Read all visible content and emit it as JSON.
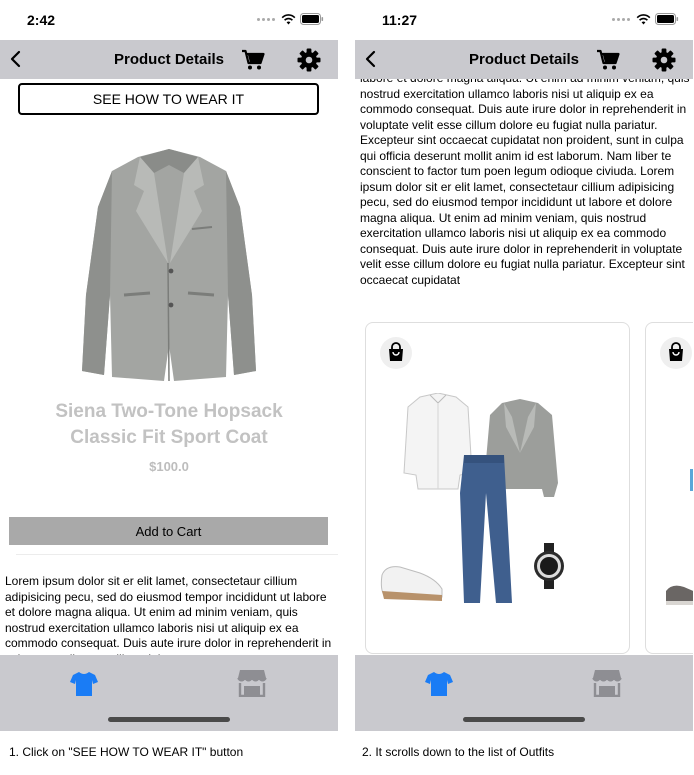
{
  "screens": [
    {
      "status": {
        "time": "2:42"
      },
      "nav": {
        "title": "Product Details",
        "back_icon": "chevron-left-icon",
        "cart_icon": "cart-icon",
        "settings_icon": "gear-icon"
      },
      "wear_button_label": "SEE HOW TO WEAR IT",
      "product": {
        "name_line1": "Siena Two-Tone Hopsack",
        "name_line2": "Classic Fit Sport Coat",
        "price": "$100.0",
        "add_to_cart_label": "Add to Cart"
      },
      "description": "Lorem ipsum dolor sit er elit lamet, consectetaur cillium adipisicing pecu, sed do eiusmod tempor incididunt ut labore et dolore magna aliqua. Ut enim ad minim veniam, quis nostrud exercitation ullamco laboris nisi ut aliquip ex ea commodo consequat. Duis aute irure dolor in reprehenderit in voluptate velit esse cillum dolore eu",
      "tabs": {
        "shop_icon": "shirt-icon",
        "store_icon": "store-icon"
      },
      "caption": "1. Click on \"SEE HOW TO WEAR IT\" button"
    },
    {
      "status": {
        "time": "11:27"
      },
      "nav": {
        "title": "Product Details",
        "back_icon": "chevron-left-icon",
        "cart_icon": "cart-icon",
        "settings_icon": "gear-icon"
      },
      "description": "labore et dolore magna aliqua. Ut enim ad minim veniam, quis nostrud exercitation ullamco laboris nisi ut aliquip ex ea commodo consequat. Duis aute irure dolor in reprehenderit in voluptate velit esse cillum dolore eu fugiat nulla pariatur. Excepteur sint occaecat cupidatat non proident, sunt in culpa qui officia deserunt mollit anim id est laborum. Nam liber te conscient to factor tum poen legum odioque civiuda. Lorem ipsum dolor sit er elit lamet, consectetaur cillium adipisicing pecu, sed do eiusmod tempor incididunt ut labore et dolore magna aliqua. Ut enim ad minim veniam, quis nostrud exercitation ullamco laboris nisi ut aliquip ex ea commodo consequat. Duis aute irure dolor in reprehenderit in voluptate velit esse cillum dolore eu fugiat nulla pariatur. Excepteur sint occaecat cupidatat",
      "outfit_icon": "shopping-bag-icon",
      "tabs": {
        "shop_icon": "shirt-icon",
        "store_icon": "store-icon"
      },
      "caption": "2. It scrolls down to the list of Outfits"
    }
  ],
  "colors": {
    "bar": "#c9c9ce",
    "active_tab": "#1a7cf5",
    "inactive_tab": "#8e8e93",
    "button_gray": "#a9a9a9",
    "product_text": "#c2c2c2"
  }
}
